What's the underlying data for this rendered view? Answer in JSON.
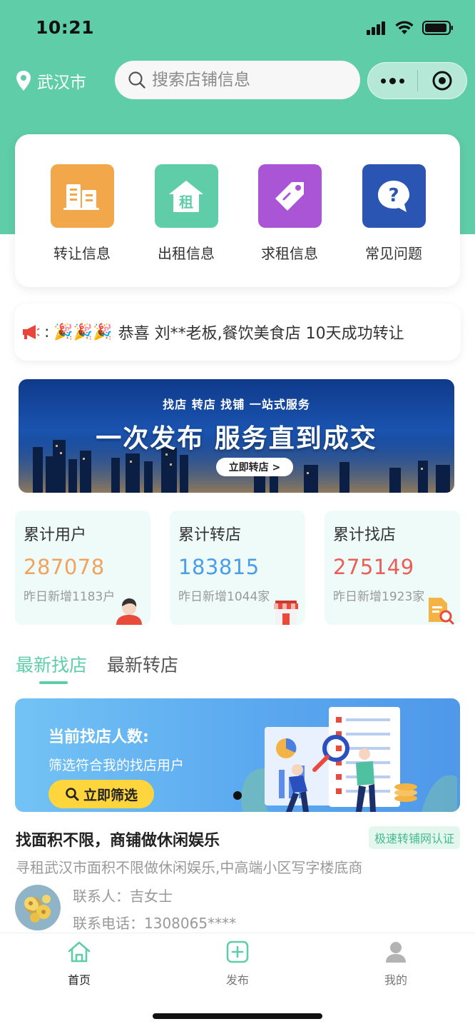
{
  "status_bar": {
    "time": "10:21"
  },
  "header": {
    "city": "武汉市",
    "search_placeholder": "搜索店铺信息"
  },
  "menu": [
    {
      "label": "转让信息",
      "icon": "building-icon",
      "color": "#f2a74b"
    },
    {
      "label": "出租信息",
      "icon": "house-rent-icon",
      "icon_text": "租",
      "color": "#5ecda8"
    },
    {
      "label": "求租信息",
      "icon": "tag-icon",
      "color": "#a955d6"
    },
    {
      "label": "常见问题",
      "icon": "question-bubble-icon",
      "color": "#2b55b3"
    }
  ],
  "notice": {
    "icon": "megaphone-icon",
    "emoji": "🎉🎉🎉",
    "text": "恭喜 刘**老板,餐饮美食店 10天成功转让"
  },
  "banner": {
    "subtitle": "找店 转店 找铺 一站式服务",
    "title": "一次发布 服务直到成交",
    "button": "立即转店 >"
  },
  "stats": [
    {
      "title": "累计用户",
      "value": "287078",
      "sub": "昨日新增1183户",
      "color": "#f0a35e",
      "icon": "user-avatar-icon"
    },
    {
      "title": "累计转店",
      "value": "183815",
      "sub": "昨日新增1044家",
      "color": "#4a9ee8",
      "icon": "storefront-icon"
    },
    {
      "title": "累计找店",
      "value": "275149",
      "sub": "昨日新增1923家",
      "color": "#e95e57",
      "icon": "document-search-icon"
    }
  ],
  "tabs": [
    {
      "label": "最新找店",
      "active": true
    },
    {
      "label": "最新转店",
      "active": false
    }
  ],
  "promo": {
    "title": "当前找店人数:",
    "subtitle": "筛选符合我的找店用户",
    "button": "立即筛选"
  },
  "listing": {
    "title": "找面积不限，商铺做休闲娱乐",
    "badge": "极速转铺网认证",
    "desc": "寻租武汉市面积不限做休闲娱乐,中高端小区写字楼底商",
    "contact_label": "联系人：",
    "contact_name": "吉女士",
    "phone_label": "联系电话：",
    "phone": "1308065****"
  },
  "tabbar": [
    {
      "label": "首页",
      "icon": "home-icon",
      "active": true
    },
    {
      "label": "发布",
      "icon": "plus-square-icon",
      "active": false
    },
    {
      "label": "我的",
      "icon": "person-icon",
      "active": false
    }
  ],
  "colors": {
    "brand": "#5ecda8"
  }
}
